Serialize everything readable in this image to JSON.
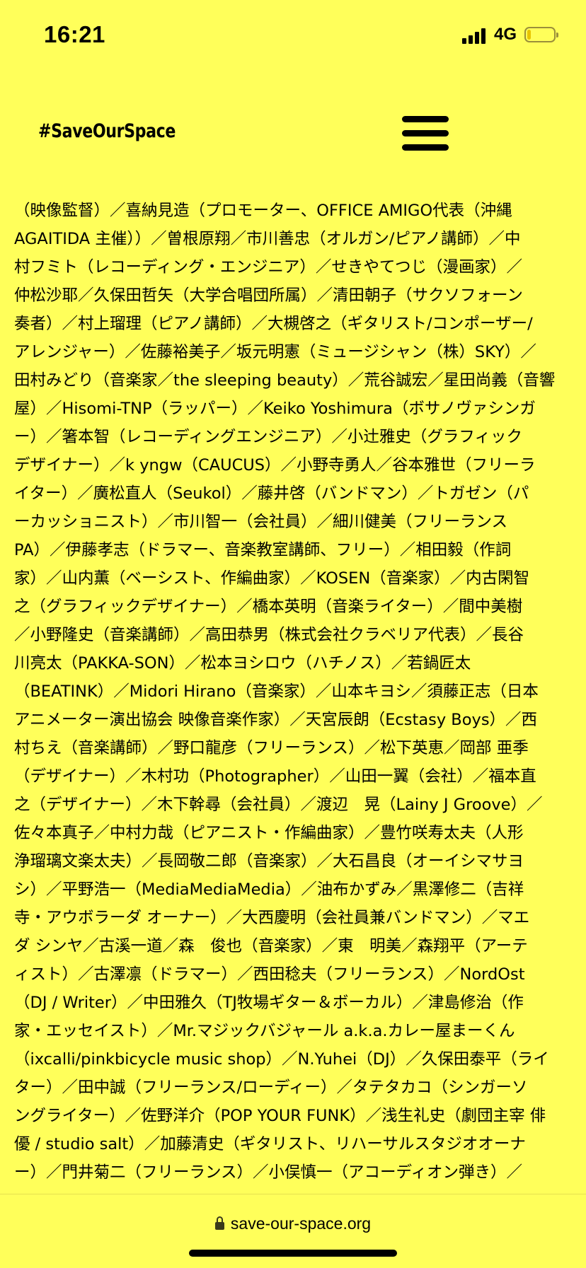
{
  "status_bar": {
    "time": "16:21",
    "network": "4G"
  },
  "header": {
    "logo": "#SaveOurSpace",
    "menu_icon": "hamburger-menu-icon"
  },
  "content": {
    "lines": [
      "（映像監督）／喜納見造（プロモーター、OFFICE AMIGO代表（沖縄",
      "AGAITIDA 主催））／曽根原翔／市川善忠（オルガン/ピアノ講師）／中",
      "村フミト（レコーディング・エンジニア）／せきやてつじ（漫画家）／",
      "仲松沙耶／久保田哲矢（大学合唱団所属）／清田朝子（サクソフォーン",
      "奏者）／村上瑠理（ピアノ講師）／大槻啓之（ギタリスト/コンポーザー/",
      "アレンジャー）／佐藤裕美子／坂元明憲（ミュージシャン（株）SKY）／",
      "田村みどり（音楽家／the sleeping beauty）／荒谷誠宏／星田尚義（音響",
      "屋）／Hisomi-TNP（ラッパー）／Keiko Yoshimura（ボサノヴァシンガ",
      "ー）／箸本智（レコーディングエンジニア）／小辻雅史（グラフィック",
      "デザイナー）／k yngw（CAUCUS）／小野寺勇人／谷本雅世（フリーラ",
      "イター）／廣松直人（Seukol）／藤井啓（バンドマン）／トガゼン（パ",
      "ーカッショニスト）／市川智一（会社員）／細川健美（フリーランス",
      "PA）／伊藤孝志（ドラマー、音楽教室講師、フリー）／相田毅（作詞",
      "家）／山内薫（ベーシスト、作編曲家）／KOSEN（音楽家）／内古閑智",
      "之（グラフィックデザイナー）／橋本英明（音楽ライター）／間中美樹",
      "／小野隆史（音楽講師）／高田恭男（株式会社クラベリア代表）／長谷",
      "川亮太（PAKKA-SON）／松本ヨシロウ（ハチノス）／若鍋匠太",
      "（BEATINK）／Midori Hirano（音楽家）／山本キヨシ／須藤正志（日本",
      "アニメーター演出協会 映像音楽作家）／天宮辰朗（Ecstasy Boys）／西",
      "村ちえ（音楽講師）／野口龍彦（フリーランス）／松下英恵／岡部 亜季",
      "（デザイナー）／木村功（Photographer）／山田一翼（会社）／福本直",
      "之（デザイナー）／木下幹尋（会社員）／渡辺　晃（Lainy J Groove）／",
      "佐々本真子／中村力哉（ピアニスト・作編曲家）／豊竹咲寿太夫（人形",
      "浄瑠璃文楽太夫）／長岡敬二郎（音楽家）／大石昌良（オーイシマサヨ",
      "シ）／平野浩一（MediaMediaMedia）／油布かずみ／黒澤修二（吉祥",
      "寺・アウボラーダ オーナー）／大西慶明（会社員兼バンドマン）／マエ",
      "ダ シンヤ／古溪一道／森　俊也（音楽家）／東　明美／森翔平（アーテ",
      "ィスト）／古澤凛（ドラマー）／西田稔夫（フリーランス）／NordOst",
      "（DJ / Writer）／中田雅久（TJ牧場ギター＆ボーカル）／津島修治（作",
      "家・エッセイスト）／Mr.マジックバジャール a.k.a.カレー屋まーくん",
      "（ixcalli/pinkbicycle music shop）／N.Yuhei（DJ）／久保田泰平（ライ",
      "ター）／田中誠（フリーランス/ローディー）／タテタカコ（シンガーソ",
      "ングライター）／佐野洋介（POP YOUR FUNK）／浅生礼史（劇団主宰 俳",
      "優 / studio salt）／加藤清史（ギタリスト、リハーサルスタジオオーナ",
      "ー）／門井菊二（フリーランス）／小俣慎一（アコーディオン弾き）／"
    ]
  },
  "footer": {
    "url": "save-our-space.org",
    "lock_icon": "lock-icon"
  },
  "colors": {
    "background": "#FFFF5A",
    "text": "#000000"
  }
}
